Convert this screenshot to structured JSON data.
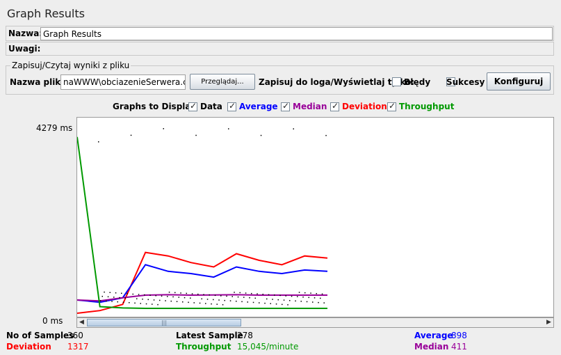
{
  "title": "Graph Results",
  "name_label": "Nazwa:",
  "name_value": "Graph Results",
  "comments_label": "Uwagi:",
  "comments_value": "",
  "file_group_title": "Zapisuj/Czytaj wyniki z pliku",
  "filename_label": "Nazwa pliku",
  "filename_value": "naWWW\\obciazenieSerwera.csv",
  "browse_button": "Przeglądaj...",
  "log_label": "Zapisuj do loga/Wyświetlaj tylko:",
  "errors_label": "Błędy",
  "success_label": "Sukcesy",
  "configure_button": "Konfiguruj",
  "graphs_label": "Graphs to Display",
  "legend": [
    {
      "label": "Data",
      "color": "#000000",
      "checked": true
    },
    {
      "label": "Average",
      "color": "#0000ff",
      "checked": true
    },
    {
      "label": "Median",
      "color": "#990099",
      "checked": true
    },
    {
      "label": "Deviation",
      "color": "#ff0000",
      "checked": true
    },
    {
      "label": "Throughput",
      "color": "#009900",
      "checked": true
    }
  ],
  "y_max_label": "4279 ms",
  "y_min_label": "0 ms",
  "stats": {
    "samples_label": "No of Samples",
    "samples_value": "360",
    "latest_label": "Latest Sample",
    "latest_value": "278",
    "average_label": "Average",
    "average_value": "898",
    "deviation_label": "Deviation",
    "deviation_value": "1317",
    "throughput_label": "Throughput",
    "throughput_value": "15,045/minute",
    "median_label": "Median",
    "median_value": "411"
  },
  "chart_data": {
    "type": "line",
    "ylim": [
      0,
      4279
    ],
    "series": [
      {
        "name": "Deviation",
        "color": "#ff0000",
        "values": [
          0,
          60,
          200,
          1380,
          1300,
          1150,
          1050,
          1350,
          1200,
          1100,
          1300,
          1250
        ]
      },
      {
        "name": "Average",
        "color": "#0000ff",
        "values": [
          300,
          250,
          350,
          1100,
          950,
          900,
          820,
          1050,
          950,
          900,
          980,
          950
        ]
      },
      {
        "name": "Median",
        "color": "#990099",
        "values": [
          300,
          280,
          350,
          411,
          420,
          410,
          415,
          420,
          411,
          411,
          411,
          411
        ]
      },
      {
        "name": "Throughput",
        "color": "#009900",
        "values": [
          4000,
          150,
          120,
          110,
          110,
          110,
          110,
          110,
          110,
          110,
          110,
          110
        ]
      }
    ]
  }
}
